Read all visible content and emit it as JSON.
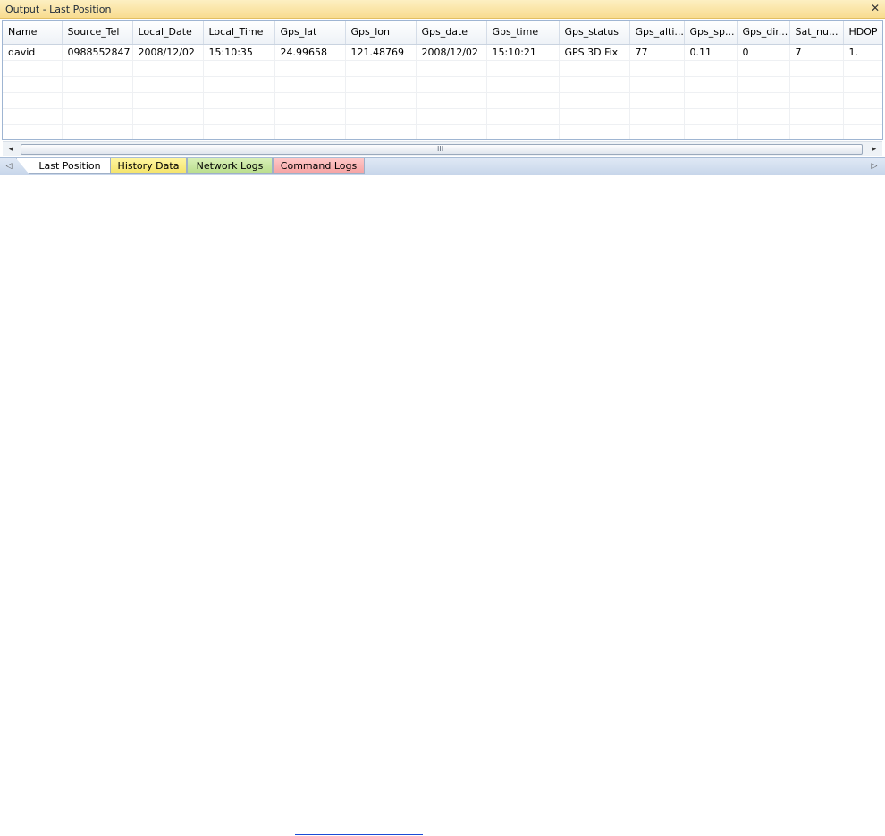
{
  "window": {
    "title": "Output - Last Position",
    "close_glyph": "✕"
  },
  "table": {
    "columns": [
      "Name",
      "Source_Tel",
      "Local_Date",
      "Local_Time",
      "Gps_lat",
      "Gps_lon",
      "Gps_date",
      "Gps_time",
      "Gps_status",
      "Gps_alti...",
      "Gps_sp...",
      "Gps_dir...",
      "Sat_nu...",
      "HDOP"
    ],
    "rows": [
      [
        "david",
        "0988552847",
        "2008/12/02",
        "15:10:35",
        "24.99658",
        "121.48769",
        "2008/12/02",
        "15:10:21",
        "GPS 3D Fix",
        "77",
        "0.11",
        "0",
        "7",
        "1."
      ]
    ],
    "empty_row_count": 5
  },
  "scrollbar": {
    "left_icon": "scroll-left-arrow-icon",
    "right_icon": "scroll-right-arrow-icon",
    "grip": "III"
  },
  "tabs": [
    {
      "label": "Last Position",
      "color": "#ffffff"
    },
    {
      "label": "History Data",
      "color": "#f4e36a"
    },
    {
      "label": "Network Logs",
      "color": "#b9dd8c"
    },
    {
      "label": "Command Logs",
      "color": "#f5a3a3"
    }
  ]
}
